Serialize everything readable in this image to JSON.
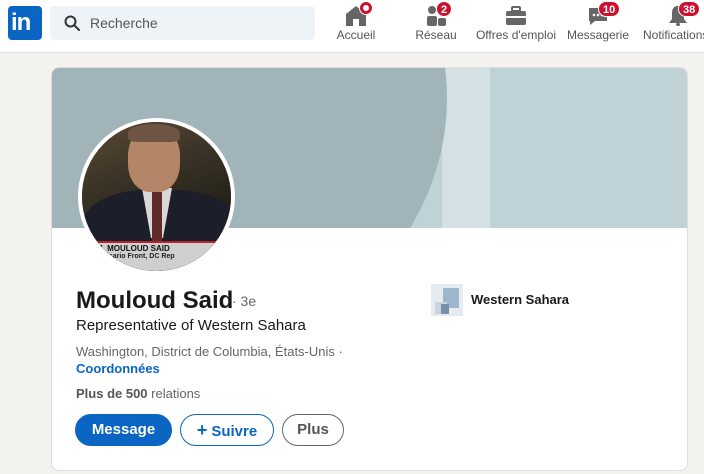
{
  "nav": {
    "logo_text": "in",
    "search_placeholder": "Recherche",
    "items": [
      {
        "label": "Accueil",
        "badge": "",
        "icon": "home-icon"
      },
      {
        "label": "Réseau",
        "badge": "2",
        "icon": "network-icon"
      },
      {
        "label": "Offres d'emploi",
        "badge": "",
        "icon": "briefcase-icon"
      },
      {
        "label": "Messagerie",
        "badge": "10",
        "icon": "messaging-icon"
      },
      {
        "label": "Notifications",
        "badge": "38",
        "icon": "bell-icon"
      }
    ]
  },
  "profile": {
    "name": "Mouloud Said",
    "degree": "· 3e",
    "headline": "Representative of Western Sahara",
    "location": "Washington, District de Columbia, États-Unis ·",
    "contact_link": "Coordonnées",
    "connections_count": "Plus de 500",
    "connections_label": "relations",
    "photo_caption_line1": "M. MOULOUD SAID",
    "photo_caption_line2": "Polisario Front, DC Rep",
    "organization": "Western Sahara"
  },
  "actions": {
    "message": "Message",
    "follow_icon": "+",
    "follow": "Suivre",
    "more": "Plus"
  },
  "colors": {
    "brand": "#0a66c2",
    "badge": "#cb112d",
    "banner": "#bfd2d8"
  }
}
